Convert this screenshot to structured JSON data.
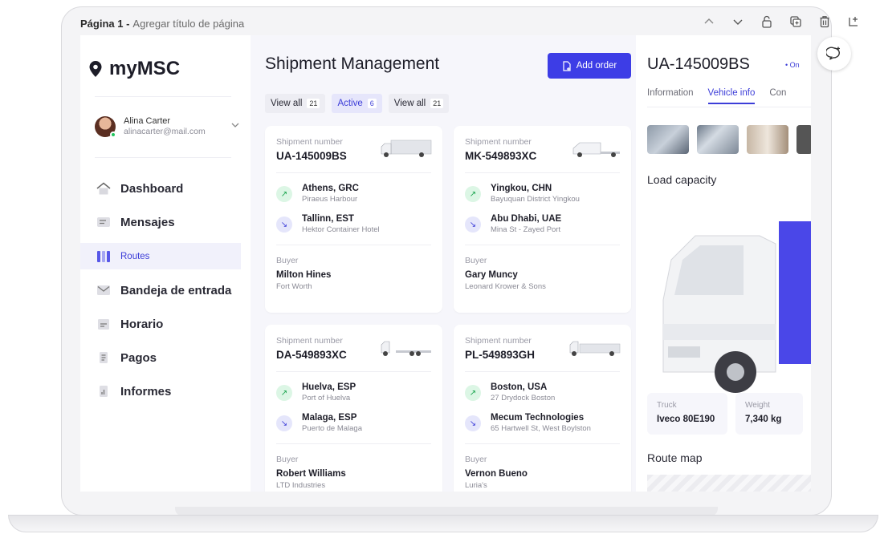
{
  "page_bar": {
    "page_number": "Página 1 -",
    "page_title": "Agregar título de página"
  },
  "sidebar": {
    "logo": "myMSC",
    "user": {
      "name": "Alina Carter",
      "email": "alinacarter@mail.com"
    },
    "items": [
      {
        "label": "Dashboard",
        "icon": "home-icon"
      },
      {
        "label": "Mensajes",
        "icon": "message-icon"
      },
      {
        "label": "Routes",
        "icon": "routes-icon",
        "active": true
      },
      {
        "label": "Bandeja de entrada",
        "icon": "inbox-icon"
      },
      {
        "label": "Horario",
        "icon": "calendar-icon"
      },
      {
        "label": "Pagos",
        "icon": "wallet-icon"
      },
      {
        "label": "Informes",
        "icon": "report-icon"
      }
    ]
  },
  "main": {
    "title": "Shipment Management",
    "add_button": "Add order",
    "filters": [
      {
        "label": "View all",
        "count": "21"
      },
      {
        "label": "Active",
        "count": "6"
      },
      {
        "label": "View all",
        "count": "21"
      }
    ],
    "shipment_label": "Shipment number",
    "buyer_label": "Buyer",
    "shipments": [
      {
        "number": "UA-145009BS",
        "from_city": "Athens, GRC",
        "from_place": "Piraeus Harbour",
        "to_city": "Tallinn, EST",
        "to_place": "Hektor Container Hotel",
        "buyer": "Milton Hines",
        "buyer_company": "Fort Worth"
      },
      {
        "number": "MK-549893XC",
        "from_city": "Yingkou, CHN",
        "from_place": "Bayuquan District Yingkou",
        "to_city": "Abu Dhabi, UAE",
        "to_place": "Mina St - Zayed Port",
        "buyer": "Gary Muncy",
        "buyer_company": "Leonard Krower & Sons"
      },
      {
        "number": "DA-549893XC",
        "from_city": "Huelva, ESP",
        "from_place": "Port of Huelva",
        "to_city": "Malaga, ESP",
        "to_place": "Puerto de Malaga",
        "buyer": "Robert Williams",
        "buyer_company": "LTD Industries"
      },
      {
        "number": "PL-549893GH",
        "from_city": "Boston, USA",
        "from_place": "27 Drydock Boston",
        "to_city": "Mecum Technologies",
        "to_place": "65 Hartwell St, West Boylston",
        "buyer": "Vernon Bueno",
        "buyer_company": "Luria's"
      }
    ]
  },
  "detail": {
    "title": "UA-145009BS",
    "status": "• On",
    "tabs": [
      "Information",
      "Vehicle info",
      "Con"
    ],
    "active_tab": "Vehicle info",
    "load_capacity": "Load capacity",
    "truck_label": "Truck",
    "truck_value": "Iveco 80E190",
    "weight_label": "Weight",
    "weight_value": "7,340 kg",
    "route_map": "Route map"
  },
  "colors": {
    "accent": "#3d3de6",
    "success": "#16a34a",
    "panel_bg": "#f6f6fb"
  }
}
